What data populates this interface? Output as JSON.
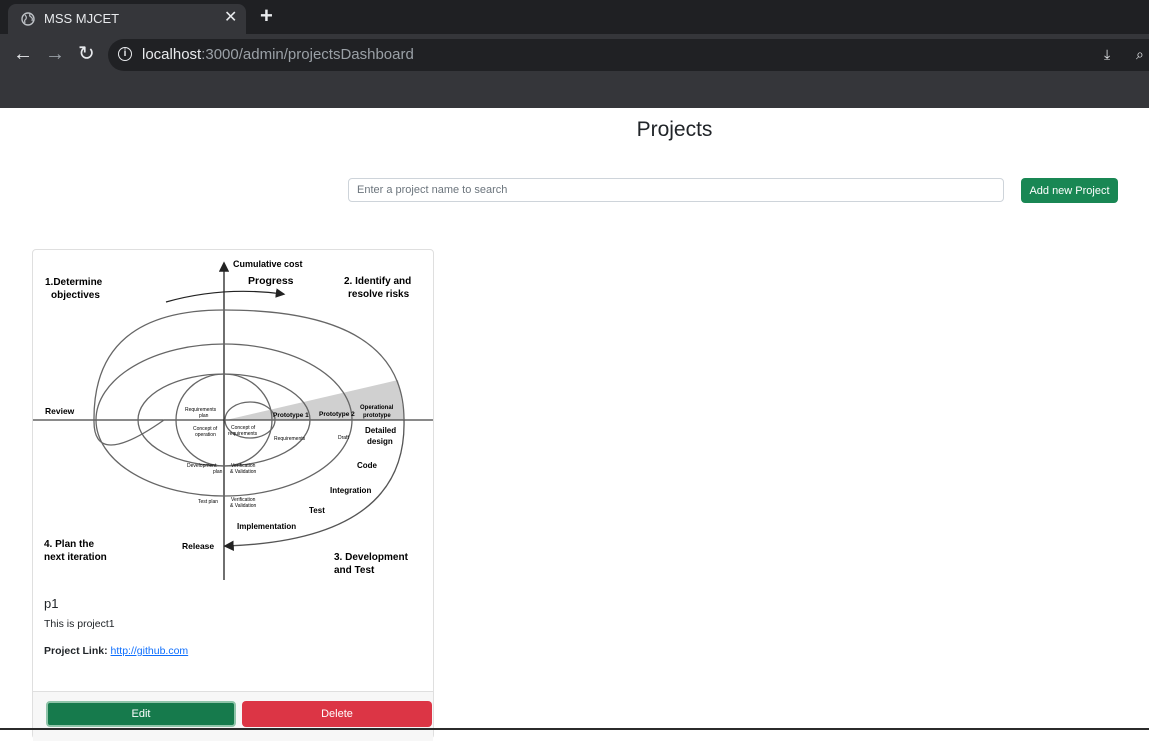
{
  "browser": {
    "tab_title": "MSS MJCET",
    "url_host": "localhost",
    "url_rest": ":3000/admin/projectsDashboard"
  },
  "page": {
    "title": "Projects",
    "search_placeholder": "Enter a project name to search",
    "add_button": "Add new Project"
  },
  "projects": [
    {
      "name": "p1",
      "description": "This is project1",
      "link_label": "Project Link:",
      "link": "http://github.com",
      "edit_label": "Edit",
      "delete_label": "Delete"
    }
  ],
  "diagram": {
    "cumulative_cost": "Cumulative cost",
    "progress": "Progress",
    "q1_line1": "1.Determine",
    "q1_line2": "objectives",
    "q2_line1": "2. Identify and",
    "q2_line2": "resolve risks",
    "q3_line1": "3. Development",
    "q3_line2": "and Test",
    "q4_line1": "4. Plan the",
    "q4_line2": "next iteration",
    "review": "Review",
    "release": "Release",
    "req_plan_1": "Requirements",
    "req_plan_2": "plan",
    "concept_op_1": "Concept of",
    "concept_op_2": "operation",
    "concept_req_1": "Concept of",
    "concept_req_2": "requirements",
    "prototype1": "Prototype 1",
    "prototype2": "Prototype 2",
    "op_proto_1": "Operational",
    "op_proto_2": "prototype",
    "requirements": "Requirements",
    "draft": "Draft",
    "detailed_1": "Detailed",
    "detailed_2": "design",
    "dev_plan_1": "Development",
    "dev_plan_2": "plan",
    "vv1_1": "Verification",
    "vv1_2": "& Validation",
    "code": "Code",
    "integration": "Integration",
    "test_plan": "Test plan",
    "vv2_1": "Verification",
    "vv2_2": "& Validation",
    "test": "Test",
    "implementation": "Implementation"
  }
}
